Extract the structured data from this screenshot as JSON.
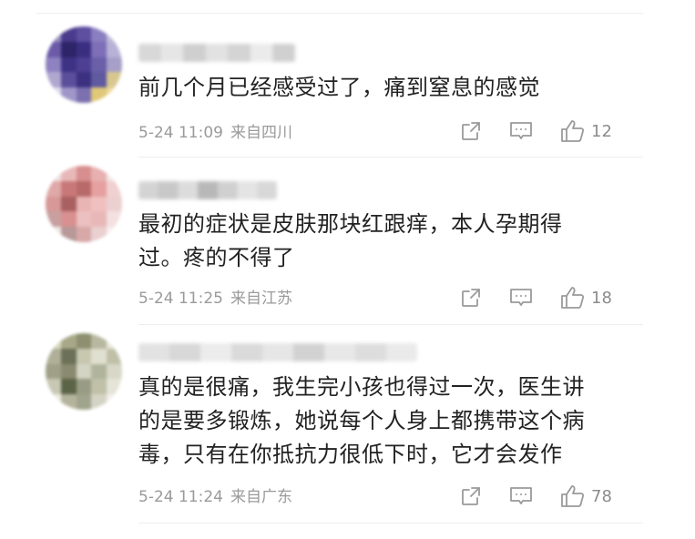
{
  "comments": [
    {
      "text": "前几个月已经感受过了，痛到窒息的感觉",
      "time": "5-24 11:09",
      "location": "来自四川",
      "likes": "12",
      "avatar_colors": [
        "#9a8fc0",
        "#4a3b8c",
        "#5e4fa0",
        "#8a7fc0",
        "#c0bbd8",
        "#6a5aa8",
        "#2e2468",
        "#3a2e80",
        "#7e6fb8",
        "#b8b2d6",
        "#8e82c0",
        "#3e3285",
        "#4e3f95",
        "#6a5fa8",
        "#a69fc8",
        "#b0a8d0",
        "#5b4e9a",
        "#3c3080",
        "#605aa0",
        "#d8c890",
        "#e0dcec",
        "#a097c8",
        "#7c70b0",
        "#e0c878",
        "#ecd89a"
      ],
      "username_colors": [
        "#d8d8d8",
        "#e6e6e6",
        "#cfcfcf",
        "#e2e2e2",
        "#d4d4d4",
        "#ebebeb",
        "#d0d0d0"
      ]
    },
    {
      "text": "最初的症状是皮肤那块红跟痒，本人孕期得\n过。疼的不得了",
      "time": "5-24 11:25",
      "location": "来自江苏",
      "likes": "18",
      "avatar_colors": [
        "#f0e0e0",
        "#e8b8b8",
        "#d88e8e",
        "#e8b0b0",
        "#f4e8e8",
        "#e0a8a8",
        "#c87878",
        "#b86a6a",
        "#e6a0a0",
        "#f0d0d0",
        "#d89898",
        "#a86060",
        "#e8b4b4",
        "#f0c0c0",
        "#ecd0d0",
        "#c8a0a0",
        "#d89090",
        "#ecc0c0",
        "#e8b8b8",
        "#f4e0e0",
        "#f2e6e6",
        "#b89898",
        "#d8a8a8",
        "#ead0d0",
        "#f8eeee"
      ],
      "username_colors": [
        "#d4d4d4",
        "#c8c8c8",
        "#dcdcdc",
        "#b8b8b8",
        "#d0d0d0",
        "#e4e4e4",
        "#d8d8d8"
      ]
    },
    {
      "text": "真的是很痛，我生完小孩也得过一次，医生讲\n的是要多锻炼，她说每个人身上都携带这个病\n毒，只有在你抵抗力很低下时，它才会发作",
      "time": "5-24 11:24",
      "location": "来自广东",
      "likes": "78",
      "avatar_colors": [
        "#d8d8c0",
        "#a8a888",
        "#8c9070",
        "#b8b8a0",
        "#e8e8dc",
        "#b0b098",
        "#6c7058",
        "#c8c8b0",
        "#e0e0d0",
        "#c0c0a8",
        "#a0a088",
        "#8a8a70",
        "#d4d4c4",
        "#b0b49c",
        "#d8d8c8",
        "#c8c8b4",
        "#5c6448",
        "#989c84",
        "#c0c0a8",
        "#e4e4d8",
        "#ecece4",
        "#b4b49c",
        "#a0a48c",
        "#d4d4c4",
        "#f0f0ea"
      ],
      "username_colors": [
        "#e2e2e2",
        "#d8d8d8",
        "#ececec",
        "#dadada",
        "#e6e6e6",
        "#d2d2d2",
        "#e8e8e8",
        "#dddddd",
        "#eaeaea"
      ]
    }
  ]
}
